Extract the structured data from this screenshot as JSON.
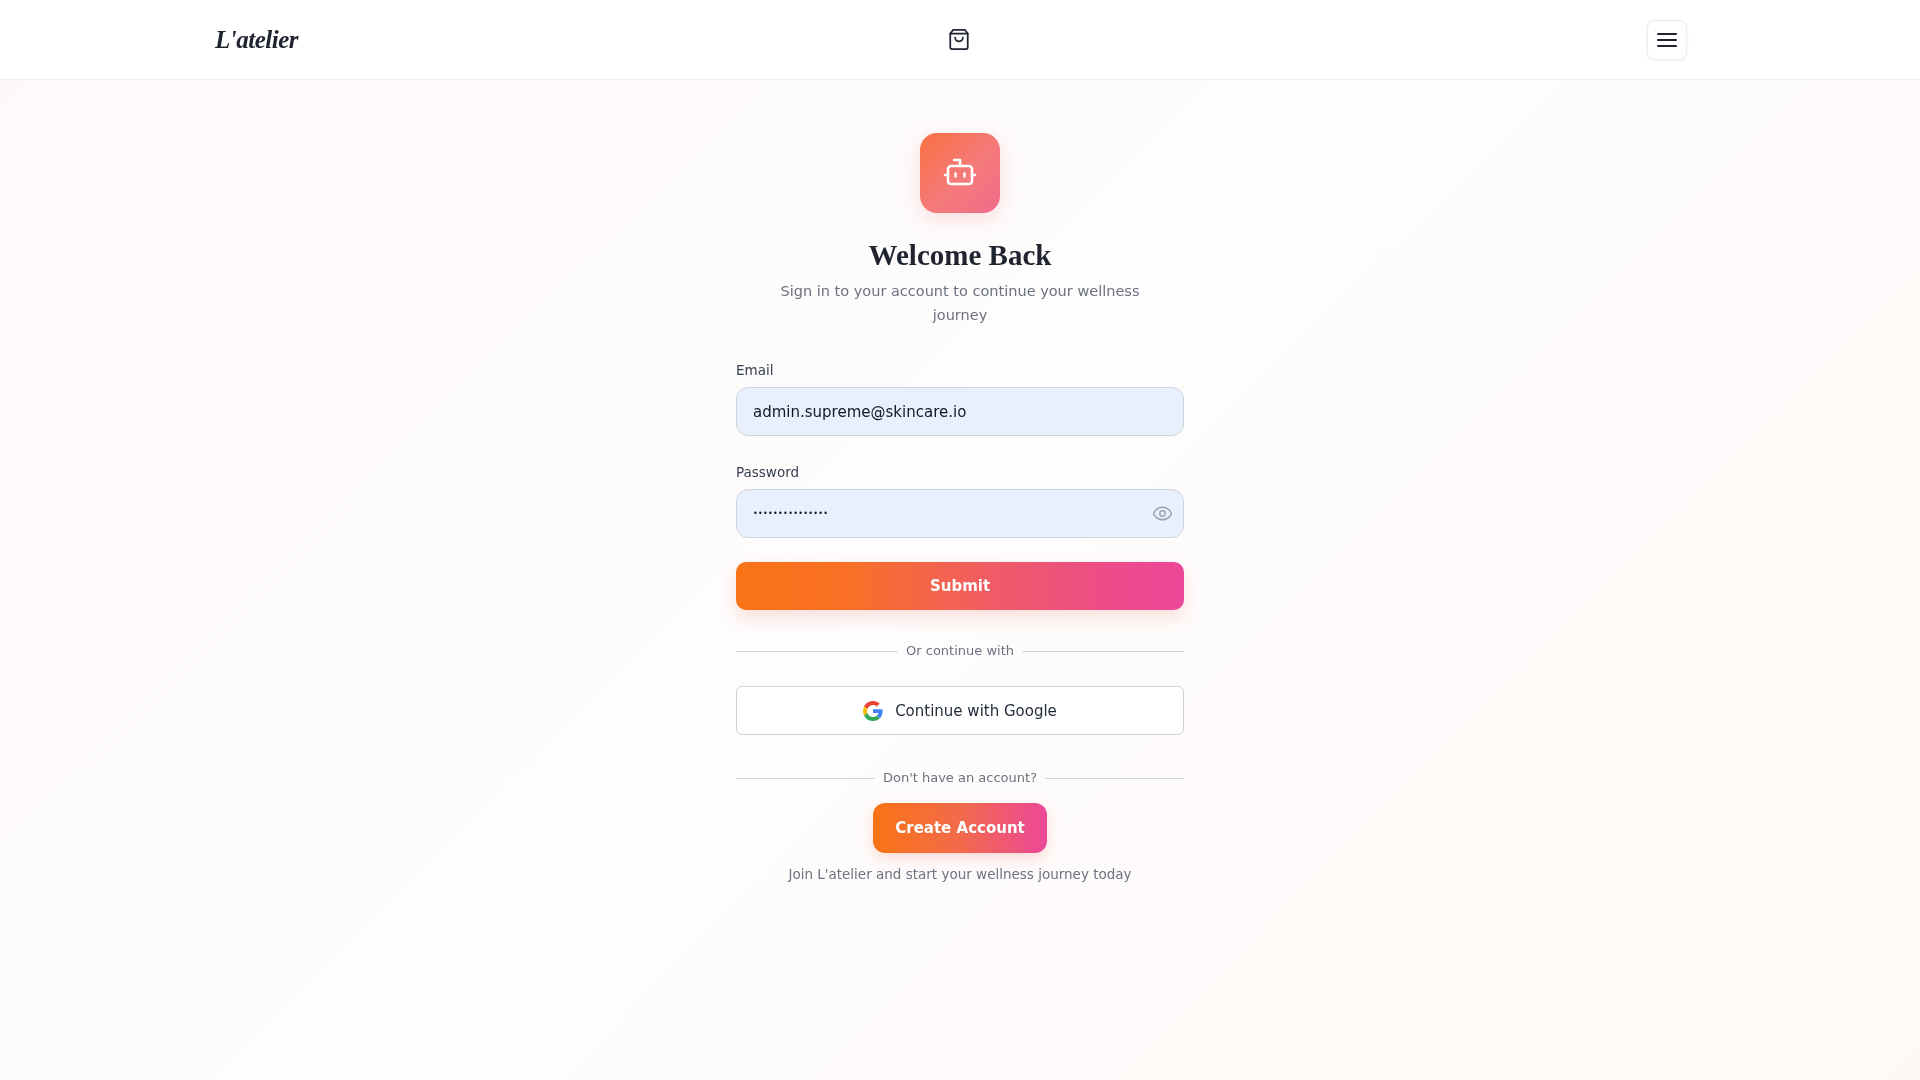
{
  "header": {
    "logo": "L'atelier"
  },
  "login": {
    "title": "Welcome Back",
    "subtitle": "Sign in to your account to continue your wellness journey",
    "fields": [
      {
        "kind": "email",
        "label": "Email",
        "value": "admin.supreme@skincare.io"
      },
      {
        "kind": "password",
        "label": "Password",
        "value": "•••••••••••••••"
      }
    ],
    "submit": "Submit",
    "divider": "Or continue with",
    "google_button": "Continue with Google",
    "signup_divider": "Don't have an account?",
    "create_account": "Create Account",
    "footnote": "Join L'atelier and start your wellness journey today"
  }
}
